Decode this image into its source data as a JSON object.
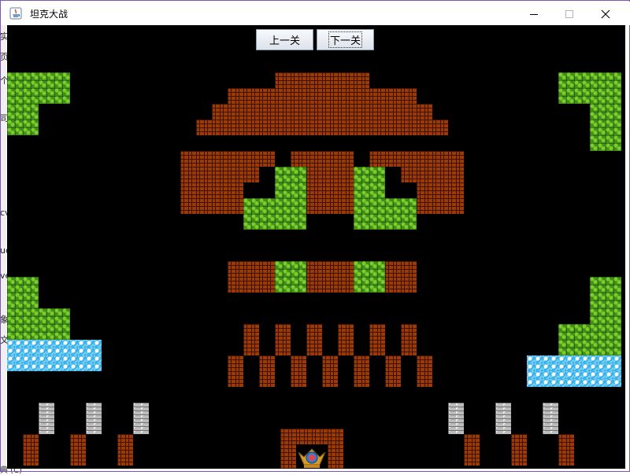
{
  "window": {
    "title": "坦克大战",
    "controls": [
      "minimize-icon",
      "maximize-icon",
      "close-icon"
    ]
  },
  "toolbar": {
    "prev_label": "上一关",
    "next_label": "下一关"
  },
  "background_fragments": [
    "实",
    "页",
    "个",
    "司",
    "cv",
    "uc",
    "ve",
    "象",
    "文",
    "典 (C)"
  ],
  "colors": {
    "brick": "#9c3a06",
    "brick_mortar": "#3d1200",
    "grass": "#3f8f1a",
    "grass_light": "#7dcc2a",
    "water": "#3ab0e8",
    "steel": "#bcbcbc",
    "background": "#000000"
  },
  "tiles": {
    "brick": [
      [
        340,
        60,
        120,
        20
      ],
      [
        280,
        80,
        240,
        20
      ],
      [
        260,
        100,
        280,
        20
      ],
      [
        240,
        120,
        320,
        20
      ],
      [
        220,
        160,
        120,
        20
      ],
      [
        360,
        160,
        80,
        20
      ],
      [
        460,
        160,
        120,
        20
      ],
      [
        220,
        180,
        100,
        20
      ],
      [
        380,
        180,
        60,
        20
      ],
      [
        500,
        180,
        80,
        20
      ],
      [
        220,
        200,
        80,
        20
      ],
      [
        380,
        200,
        60,
        20
      ],
      [
        520,
        200,
        60,
        20
      ],
      [
        220,
        220,
        80,
        20
      ],
      [
        380,
        220,
        60,
        20
      ],
      [
        520,
        220,
        60,
        20
      ],
      [
        280,
        300,
        60,
        20
      ],
      [
        380,
        300,
        60,
        20
      ],
      [
        480,
        300,
        40,
        20
      ],
      [
        280,
        320,
        60,
        20
      ],
      [
        380,
        320,
        60,
        20
      ],
      [
        480,
        320,
        40,
        20
      ],
      [
        300,
        380,
        20,
        40
      ],
      [
        340,
        380,
        20,
        40
      ],
      [
        380,
        380,
        20,
        40
      ],
      [
        420,
        380,
        20,
        40
      ],
      [
        460,
        380,
        20,
        40
      ],
      [
        500,
        380,
        20,
        40
      ],
      [
        280,
        420,
        20,
        40
      ],
      [
        320,
        420,
        20,
        40
      ],
      [
        360,
        420,
        20,
        40
      ],
      [
        400,
        420,
        20,
        40
      ],
      [
        440,
        420,
        20,
        40
      ],
      [
        480,
        420,
        20,
        40
      ],
      [
        520,
        420,
        20,
        40
      ],
      [
        20,
        520,
        20,
        40
      ],
      [
        80,
        520,
        20,
        40
      ],
      [
        140,
        520,
        20,
        40
      ],
      [
        580,
        520,
        20,
        40
      ],
      [
        640,
        520,
        20,
        40
      ],
      [
        700,
        520,
        20,
        40
      ],
      [
        347,
        513,
        80,
        20
      ],
      [
        347,
        533,
        20,
        31
      ],
      [
        407,
        533,
        20,
        31
      ]
    ],
    "grass": [
      [
        0,
        60,
        80,
        40
      ],
      [
        0,
        100,
        40,
        40
      ],
      [
        700,
        60,
        80,
        40
      ],
      [
        740,
        100,
        40,
        60
      ],
      [
        340,
        180,
        40,
        80
      ],
      [
        300,
        220,
        40,
        40
      ],
      [
        440,
        180,
        40,
        80
      ],
      [
        480,
        220,
        40,
        40
      ],
      [
        340,
        300,
        40,
        40
      ],
      [
        440,
        300,
        40,
        40
      ],
      [
        0,
        320,
        40,
        40
      ],
      [
        0,
        360,
        80,
        40
      ],
      [
        740,
        320,
        40,
        60
      ],
      [
        700,
        380,
        80,
        40
      ]
    ],
    "water": [
      [
        0,
        400,
        120,
        40
      ],
      [
        660,
        420,
        120,
        40
      ]
    ],
    "steel": [
      [
        40,
        480,
        20,
        40
      ],
      [
        100,
        480,
        20,
        40
      ],
      [
        160,
        480,
        20,
        40
      ],
      [
        560,
        480,
        20,
        40
      ],
      [
        620,
        480,
        20,
        40
      ],
      [
        680,
        480,
        20,
        40
      ]
    ],
    "base": [
      367,
      533,
      40,
      31
    ]
  }
}
